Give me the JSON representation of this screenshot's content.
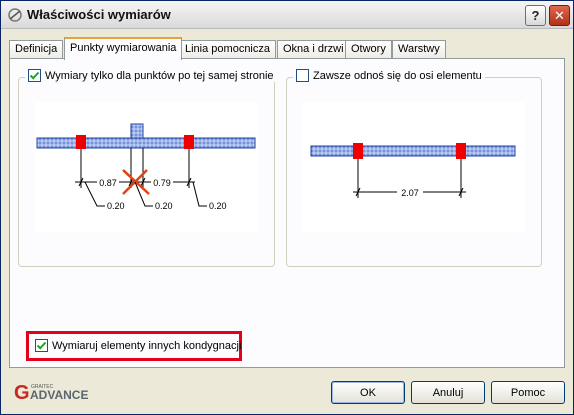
{
  "window": {
    "title": "Właściwości wymiarów",
    "help_label": "?",
    "close_label": "✕"
  },
  "tabs": [
    {
      "label": "Definicja",
      "active": false
    },
    {
      "label": "Punkty wymiarowania",
      "active": true
    },
    {
      "label": "Linia pomocnicza",
      "active": false
    },
    {
      "label": "Okna i drzwi",
      "active": false
    },
    {
      "label": "Otwory",
      "active": false
    },
    {
      "label": "Warstwy",
      "active": false
    }
  ],
  "group_left": {
    "label": "Wymiary tylko dla punktów po tej samej stronie",
    "checked": true,
    "dimensions": {
      "dim1": "0.87",
      "dim2": "0.79",
      "off1": "0.20",
      "off2": "0.20",
      "off3": "0.20"
    }
  },
  "group_right": {
    "label": "Zawsze odnoś się do osi elementu",
    "checked": false,
    "dimensions": {
      "dim1": "2.07"
    }
  },
  "other_storeys": {
    "label": "Wymiaruj elementy innych kondygnacji",
    "checked": true
  },
  "logo": {
    "small_text": "GRAITEC",
    "text": "ADVANCE",
    "letter": "G"
  },
  "buttons": {
    "ok": "OK",
    "cancel": "Anuluj",
    "help": "Pomoc"
  },
  "colors": {
    "highlight": "#e4001b",
    "dim_point": "#ee0000",
    "wall": "#9fb4e8"
  }
}
